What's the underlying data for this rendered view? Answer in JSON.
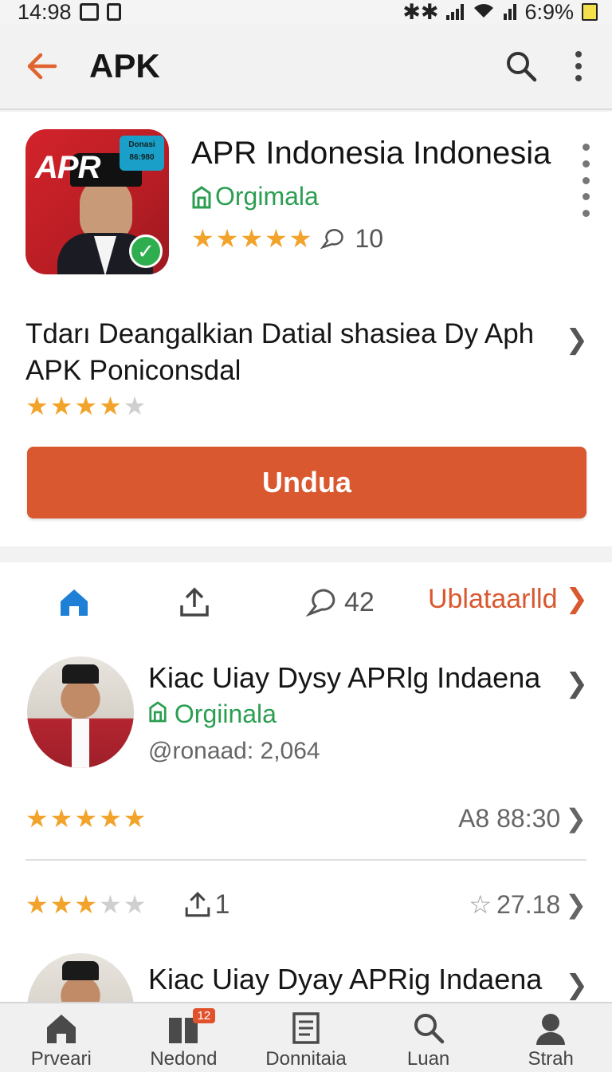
{
  "status_bar": {
    "time": "14:98",
    "battery": "6:9%"
  },
  "app_bar": {
    "title": "APK"
  },
  "app": {
    "name": "APR Indonesia Indonesia",
    "verified_label": "Orgimala",
    "rating_count": "10",
    "rating": 5,
    "icon_text": "APR",
    "icon_badge": "Donasi\n86:980",
    "description": "Tdarı Deangalkian Datial  shasiea Dy Aph APK Poniconsdal",
    "description_rating": 4,
    "download_label": "Undua"
  },
  "actions": {
    "comment_count": "42",
    "link_label": "Ublataarlld"
  },
  "reviews": [
    {
      "name": "Kiac Uiay Dysy APRlg Indaena",
      "verified_label": "Orgiinala",
      "meta": "@ronaad: 2,064",
      "rating": 5,
      "right_value": "A8 88:30"
    },
    {
      "rating": 3,
      "share_count": "1",
      "right_value": "27.18"
    },
    {
      "name": "Kiac Uiay Dyay APRig Indaena"
    }
  ],
  "bottom_nav": [
    {
      "label": "Prveari",
      "icon": "home-icon"
    },
    {
      "label": "Nedond",
      "icon": "apps-icon",
      "badge": "12"
    },
    {
      "label": "Donnitaia",
      "icon": "document-icon"
    },
    {
      "label": "Luan",
      "icon": "search-icon"
    },
    {
      "label": "Strah",
      "icon": "profile-icon"
    }
  ],
  "colors": {
    "accent": "#d9582f",
    "verified": "#2c9e52",
    "star": "#f2a32b"
  }
}
